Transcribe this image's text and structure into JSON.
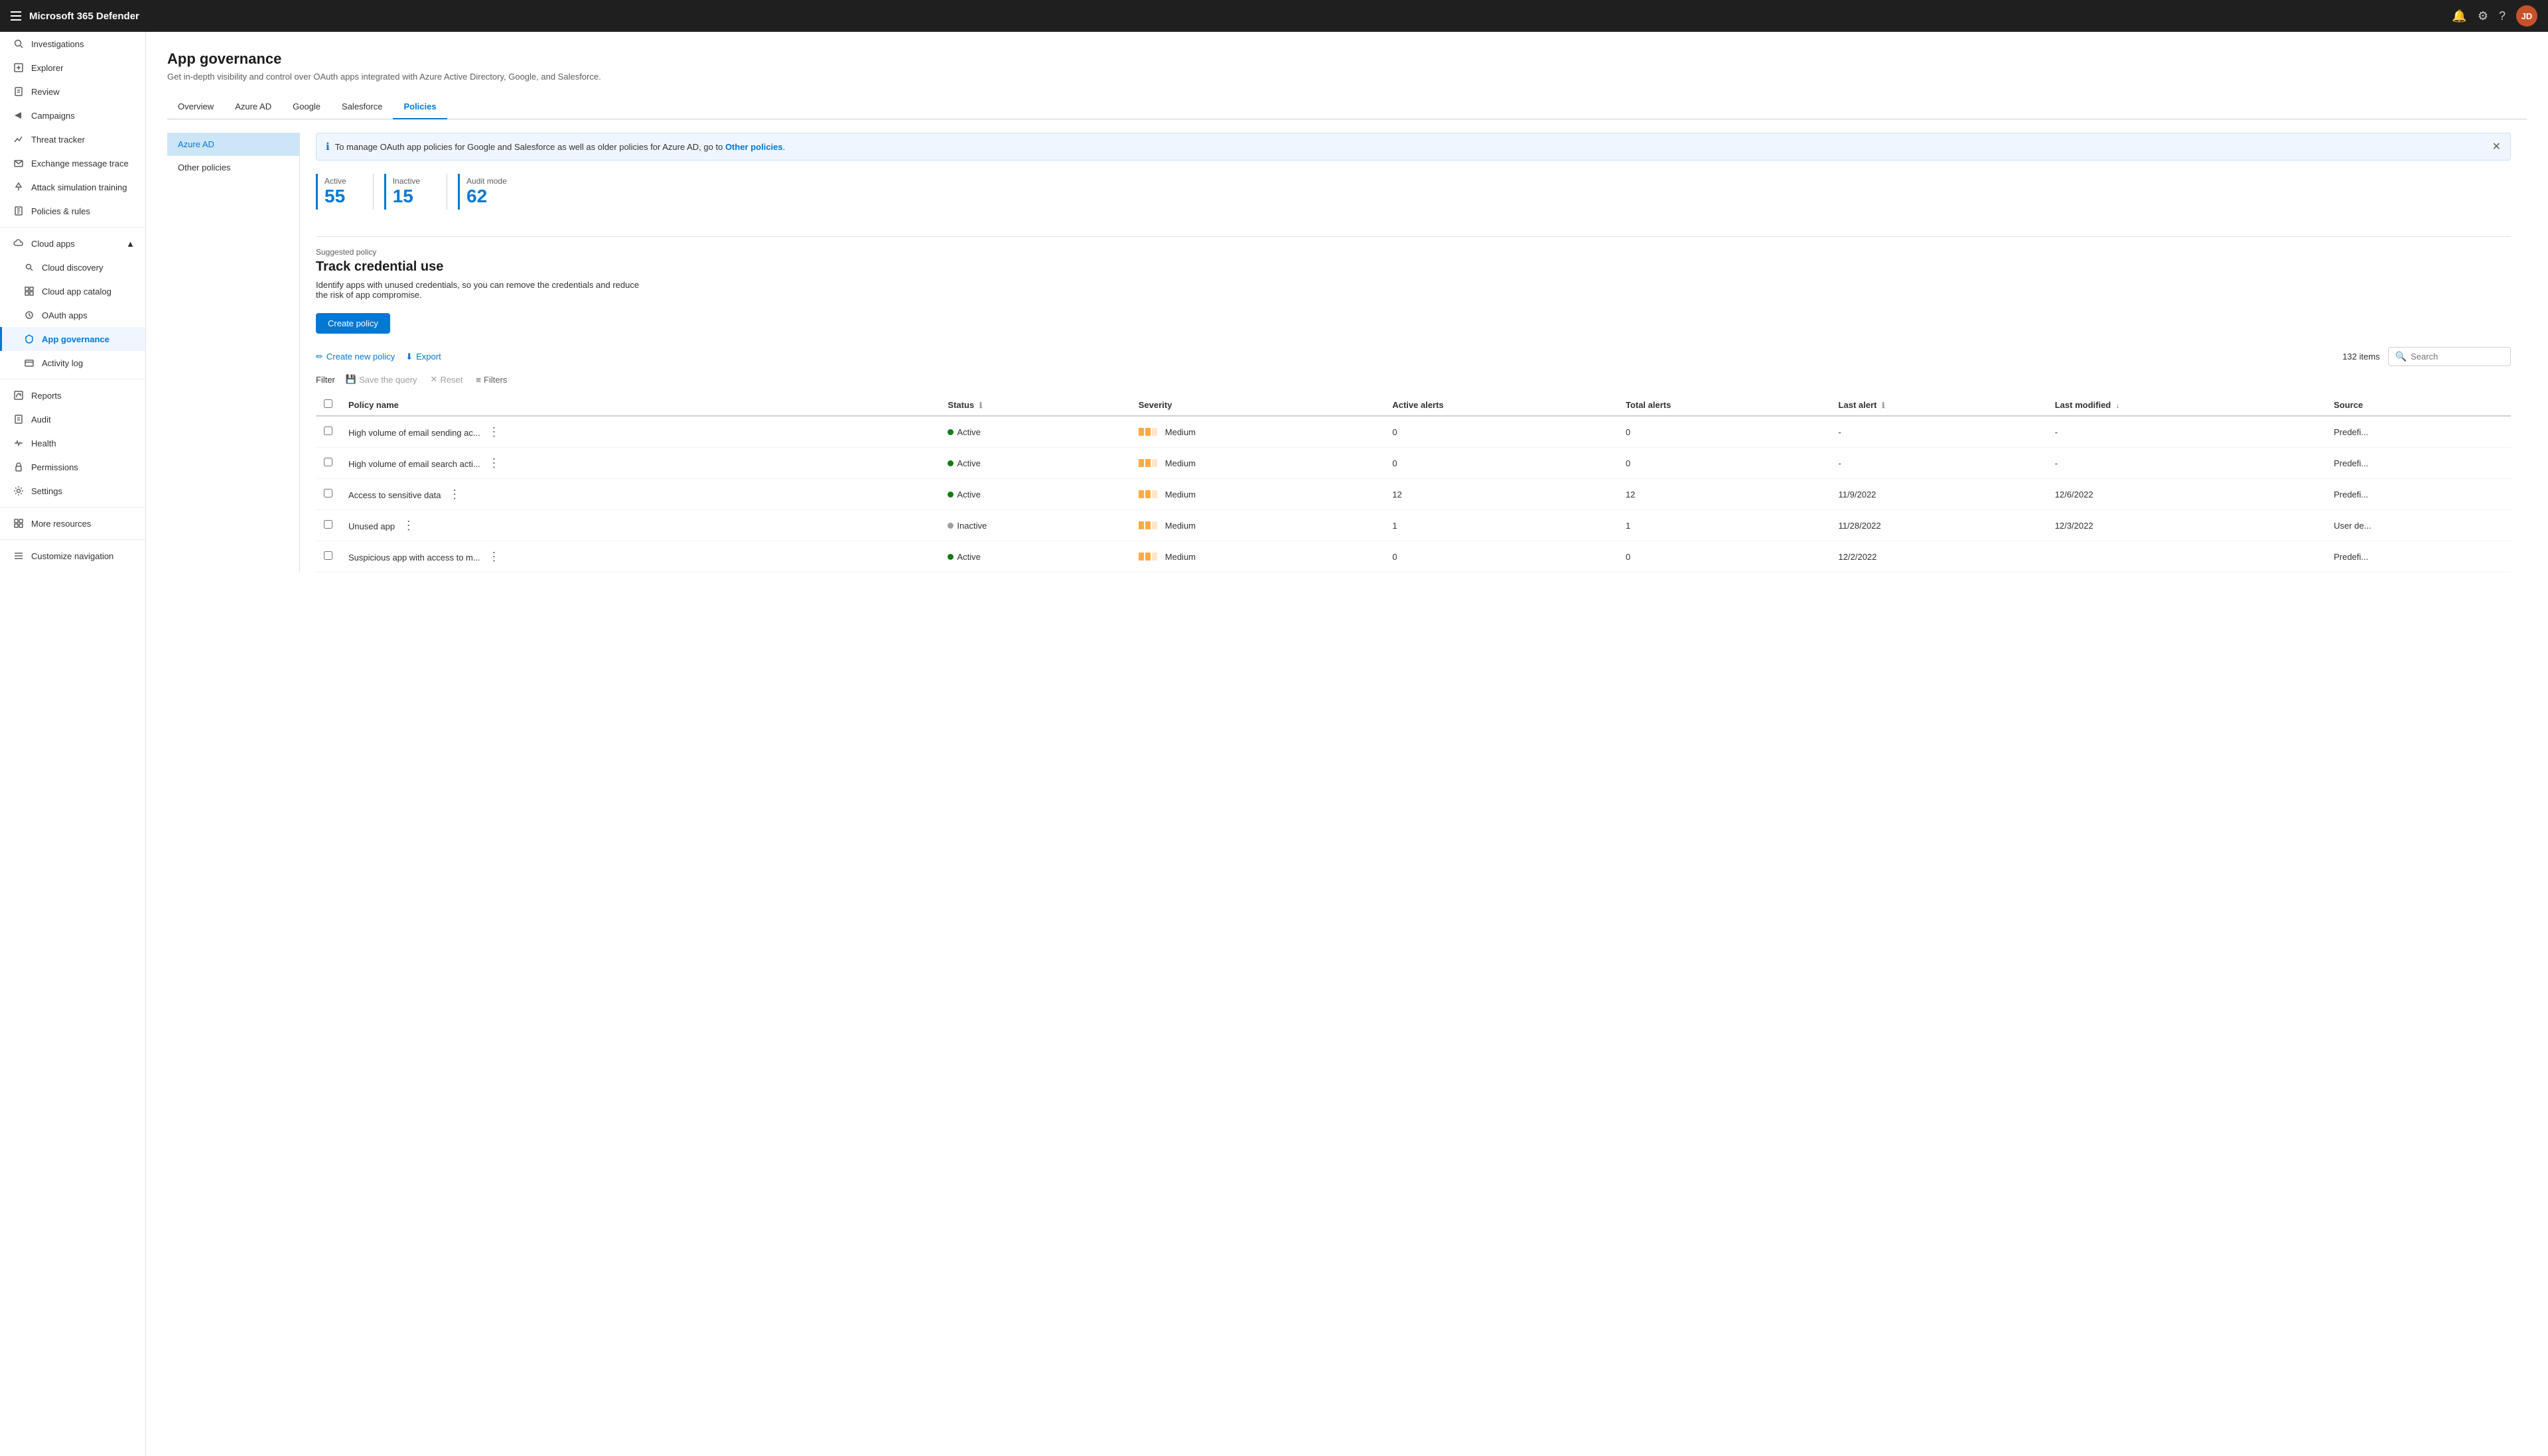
{
  "topbar": {
    "title": "Microsoft 365 Defender",
    "bell_icon": "🔔",
    "gear_icon": "⚙",
    "help_icon": "?",
    "avatar_initials": "JD"
  },
  "sidebar": {
    "items": [
      {
        "id": "investigations",
        "label": "Investigations",
        "icon": "search"
      },
      {
        "id": "explorer",
        "label": "Explorer",
        "icon": "explore"
      },
      {
        "id": "review",
        "label": "Review",
        "icon": "clipboard"
      },
      {
        "id": "campaigns",
        "label": "Campaigns",
        "icon": "megaphone"
      },
      {
        "id": "threat-tracker",
        "label": "Threat tracker",
        "icon": "chart"
      },
      {
        "id": "exchange-message-trace",
        "label": "Exchange message trace",
        "icon": "email"
      },
      {
        "id": "attack-simulation-training",
        "label": "Attack simulation training",
        "icon": "shield"
      },
      {
        "id": "policies-rules",
        "label": "Policies & rules",
        "icon": "rules"
      },
      {
        "id": "cloud-apps",
        "label": "Cloud apps",
        "icon": "cloud",
        "expandable": true
      },
      {
        "id": "cloud-discovery",
        "label": "Cloud discovery",
        "icon": "cloud-search",
        "indent": true
      },
      {
        "id": "cloud-app-catalog",
        "label": "Cloud app catalog",
        "icon": "catalog",
        "indent": true
      },
      {
        "id": "oauth-apps",
        "label": "OAuth apps",
        "icon": "oauth",
        "indent": true
      },
      {
        "id": "app-governance",
        "label": "App governance",
        "icon": "governance",
        "indent": true,
        "active": true
      },
      {
        "id": "activity-log",
        "label": "Activity log",
        "icon": "log",
        "indent": true
      },
      {
        "id": "reports",
        "label": "Reports",
        "icon": "reports"
      },
      {
        "id": "audit",
        "label": "Audit",
        "icon": "audit"
      },
      {
        "id": "health",
        "label": "Health",
        "icon": "health"
      },
      {
        "id": "permissions",
        "label": "Permissions",
        "icon": "key"
      },
      {
        "id": "settings",
        "label": "Settings",
        "icon": "gear"
      },
      {
        "id": "more-resources",
        "label": "More resources",
        "icon": "more"
      },
      {
        "id": "customize-navigation",
        "label": "Customize navigation",
        "icon": "customize"
      }
    ]
  },
  "page": {
    "title": "App governance",
    "subtitle": "Get in-depth visibility and control over OAuth apps integrated with Azure Active Directory, Google, and Salesforce."
  },
  "tabs": [
    {
      "id": "overview",
      "label": "Overview",
      "active": false
    },
    {
      "id": "azure-ad",
      "label": "Azure AD",
      "active": false
    },
    {
      "id": "google",
      "label": "Google",
      "active": false
    },
    {
      "id": "salesforce",
      "label": "Salesforce",
      "active": false
    },
    {
      "id": "policies",
      "label": "Policies",
      "active": true
    }
  ],
  "left_panel": {
    "items": [
      {
        "id": "azure-ad",
        "label": "Azure AD",
        "active": true
      },
      {
        "id": "other-policies",
        "label": "Other policies",
        "active": false
      }
    ]
  },
  "info_banner": {
    "message": "To manage OAuth app policies for Google and Salesforce as well as older policies for Azure AD, go to",
    "link_text": "Other policies",
    "link_suffix": "."
  },
  "stats": [
    {
      "label": "Active",
      "value": "55"
    },
    {
      "label": "Inactive",
      "value": "15"
    },
    {
      "label": "Audit mode",
      "value": "62"
    }
  ],
  "suggested_policy": {
    "label": "Suggested policy",
    "title": "Track credential use",
    "description": "Identify apps with unused credentials, so you can remove the credentials and reduce the risk of app compromise."
  },
  "toolbar": {
    "create_policy_label": "Create policy",
    "create_new_policy_label": "Create new policy",
    "export_label": "Export",
    "items_count": "132 items",
    "search_placeholder": "Search",
    "filter_label": "Filter",
    "save_query_label": "Save the query",
    "reset_label": "Reset",
    "filters_label": "Filters"
  },
  "table": {
    "columns": [
      {
        "id": "policy-name",
        "label": "Policy name",
        "sortable": false
      },
      {
        "id": "status",
        "label": "Status",
        "has_info": true,
        "sortable": false
      },
      {
        "id": "severity",
        "label": "Severity",
        "sortable": false
      },
      {
        "id": "active-alerts",
        "label": "Active alerts",
        "sortable": false
      },
      {
        "id": "total-alerts",
        "label": "Total alerts",
        "sortable": false
      },
      {
        "id": "last-alert",
        "label": "Last alert",
        "has_info": true,
        "sortable": false
      },
      {
        "id": "last-modified",
        "label": "Last modified",
        "sortable": true
      },
      {
        "id": "source",
        "label": "Source",
        "sortable": false
      }
    ],
    "rows": [
      {
        "id": 1,
        "policy_name": "High volume of email sending ac...",
        "status": "Active",
        "status_type": "active",
        "severity": "Medium",
        "active_alerts": "0",
        "total_alerts": "0",
        "last_alert": "-",
        "last_modified": "-",
        "source": "Predefi..."
      },
      {
        "id": 2,
        "policy_name": "High volume of email search acti...",
        "status": "Active",
        "status_type": "active",
        "severity": "Medium",
        "active_alerts": "0",
        "total_alerts": "0",
        "last_alert": "-",
        "last_modified": "-",
        "source": "Predefi..."
      },
      {
        "id": 3,
        "policy_name": "Access to sensitive data",
        "status": "Active",
        "status_type": "active",
        "severity": "Medium",
        "active_alerts": "12",
        "total_alerts": "12",
        "last_alert": "11/9/2022",
        "last_modified": "12/6/2022",
        "source": "Predefi..."
      },
      {
        "id": 4,
        "policy_name": "Unused app",
        "status": "Inactive",
        "status_type": "inactive",
        "severity": "Medium",
        "active_alerts": "1",
        "total_alerts": "1",
        "last_alert": "11/28/2022",
        "last_modified": "12/3/2022",
        "source": "User de..."
      },
      {
        "id": 5,
        "policy_name": "Suspicious app with access to m...",
        "status": "Active",
        "status_type": "active",
        "severity": "Medium",
        "active_alerts": "0",
        "total_alerts": "0",
        "last_alert": "12/2/2022",
        "last_modified": "",
        "source": "Predefi..."
      }
    ]
  }
}
